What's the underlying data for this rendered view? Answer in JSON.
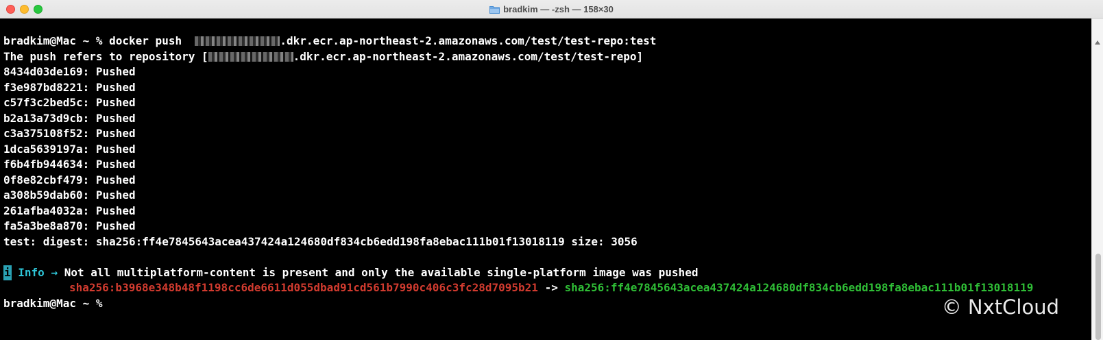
{
  "window": {
    "title": "bradkim — -zsh — 158×30"
  },
  "terminal": {
    "prompt_cmd": "bradkim@Mac ~ % docker push  ",
    "push_target_suffix": ".dkr.ecr.ap-northeast-2.amazonaws.com/test/test-repo:test",
    "refers_prefix": "The push refers to repository [",
    "refers_suffix": ".dkr.ecr.ap-northeast-2.amazonaws.com/test/test-repo]",
    "layers": [
      "8434d03de169: Pushed",
      "f3e987bd8221: Pushed",
      "c57f3c2bed5c: Pushed",
      "b2a13a73d9cb: Pushed",
      "c3a375108f52: Pushed",
      "1dca5639197a: Pushed",
      "f6b4fb944634: Pushed",
      "0f8e82cbf479: Pushed",
      "a308b59dab60: Pushed",
      "261afba4032a: Pushed",
      "fa5a3be8a870: Pushed"
    ],
    "digest_line": "test: digest: sha256:ff4e7845643acea437424a124680df834cb6edd198fa8ebac111b01f13018119 size: 3056",
    "info_icon": "i",
    "info_label": " Info → ",
    "info_text": "Not all multiplatform-content is present and only the available single-platform image was pushed",
    "sha_from": "sha256:b3968e348b48f1198cc6de6611d055dbad91cd561b7990c406c3fc28d7095b21",
    "sha_arrow": " -> ",
    "sha_to": "sha256:ff4e7845643acea437424a124680df834cb6edd198fa8ebac111b01f13018119",
    "final_prompt": "bradkim@Mac ~ % "
  },
  "watermark": "© NxtCloud",
  "colors": {
    "background": "#000000",
    "text": "#ffffff",
    "info": "#2ec4d6",
    "sha_from": "#d23b2f",
    "sha_to": "#2fbe36"
  },
  "icons": {
    "title_icon": "folder-icon"
  }
}
